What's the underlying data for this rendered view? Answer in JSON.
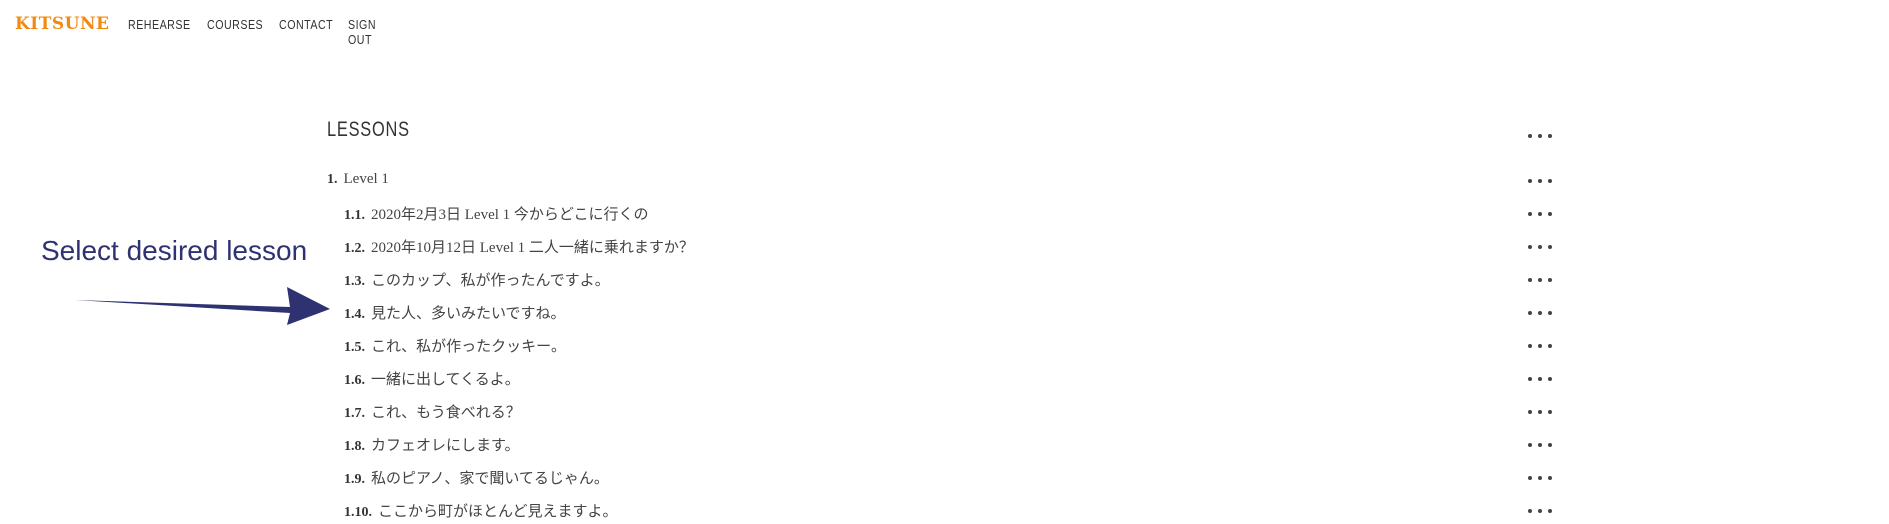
{
  "header": {
    "logo": "KITSUNE",
    "nav": [
      "REHEARSE",
      "COURSES",
      "CONTACT",
      "SIGN OUT"
    ]
  },
  "lessons": {
    "title": "LESSONS",
    "items": [
      {
        "num": "1.",
        "label": "Level 1"
      },
      {
        "num": "1.1.",
        "label": "2020年2月3日 Level 1 今からどこに行くの"
      },
      {
        "num": "1.2.",
        "label": "2020年10月12日 Level 1 二人一緒に乗れますか？"
      },
      {
        "num": "1.3.",
        "label": "このカップ、私が作ったんですよ。"
      },
      {
        "num": "1.4.",
        "label": "見た人、多いみたいですね。"
      },
      {
        "num": "1.5.",
        "label": "これ、私が作ったクッキー。"
      },
      {
        "num": "1.6.",
        "label": "一緒に出してくるよ。"
      },
      {
        "num": "1.7.",
        "label": "これ、もう食べれる？"
      },
      {
        "num": "1.8.",
        "label": "カフェオレにします。"
      },
      {
        "num": "1.9.",
        "label": "私のピアノ、家で聞いてるじゃん。"
      },
      {
        "num": "1.10.",
        "label": "ここから町がほとんど見えますよ。"
      }
    ]
  },
  "annotation": {
    "text": "Select desired lesson",
    "color": "#2f3270"
  },
  "colors": {
    "brand": "#f28a12",
    "text": "#3a3a3a"
  }
}
